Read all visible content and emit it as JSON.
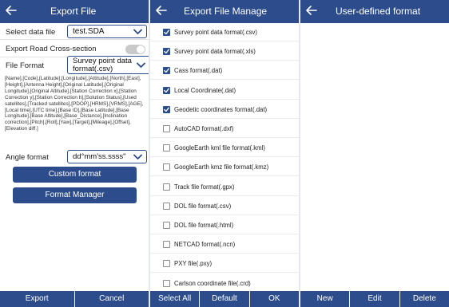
{
  "colors": {
    "primary": "#2c4c8c",
    "text": "#222222",
    "checked": "#2c4c8c",
    "toggle_off": "#c9c9c9"
  },
  "export_file": {
    "title": "Export File",
    "back_icon": "arrow-left-icon",
    "select_data_file_label": "Select data file",
    "select_data_file_value": "test.SDA",
    "road_cross_section_label": "Export Road Cross-section",
    "road_cross_section_on": false,
    "file_format_label": "File Format",
    "file_format_value": "Survey point data format(.csv)",
    "format_fields": "[Name],[Code],[Latitude],[Longitude],[Attitude],[North],[East],[Height],[Antenna Height],[Original Latitude],[Original Longitude],[Original Altitude],[Station Correction x],[Station Correction y],[Station Correction h],[Solution Status],[Used satellites],[Tracked satellites],[PDOP],[HRMS],[VRMS],[AGE],[Local time],[UTC time],[Base ID],[Base Latitude],[Base Longitude],[Base Altitude],[Base_Distance],[Inclination correction],[Pitch],[Roll],[Yaw],[Target],[Mileage],[Offset],[Elevation diff.]",
    "angle_format_label": "Angle format",
    "angle_format_value": "dd°mm'ss.ssss\"",
    "custom_format_button": "Custom format",
    "format_manager_button": "Format Manager",
    "bottom": {
      "export": "Export",
      "cancel": "Cancel"
    }
  },
  "export_file_manage": {
    "title": "Export File Manage",
    "back_icon": "arrow-left-icon",
    "items": [
      {
        "label": "Survey point data format(.csv)",
        "checked": true
      },
      {
        "label": "Survey point data format(.xls)",
        "checked": true
      },
      {
        "label": "Cass format(.dat)",
        "checked": true
      },
      {
        "label": "Local Coordinate(.dat)",
        "checked": true
      },
      {
        "label": "Geodetic coordinates format(.dat)",
        "checked": true
      },
      {
        "label": "AutoCAD format(.dxf)",
        "checked": false
      },
      {
        "label": "GoogleEarth kml file format(.kml)",
        "checked": false
      },
      {
        "label": "GoogleEarth kmz file format(.kmz)",
        "checked": false
      },
      {
        "label": "Track file format(.gpx)",
        "checked": false
      },
      {
        "label": "DOL file format(.csv)",
        "checked": false
      },
      {
        "label": "DOL file format(.html)",
        "checked": false
      },
      {
        "label": "NETCAD format(.ncn)",
        "checked": false
      },
      {
        "label": "PXY file(.pxy)",
        "checked": false
      },
      {
        "label": "Carlson coordinate file(.crd)",
        "checked": false
      }
    ],
    "bottom": {
      "select_all": "Select All",
      "default": "Default",
      "ok": "OK"
    }
  },
  "user_defined_format": {
    "title": "User-defined format",
    "back_icon": "arrow-left-icon",
    "bottom": {
      "new": "New",
      "edit": "Edit",
      "delete": "Delete"
    }
  }
}
